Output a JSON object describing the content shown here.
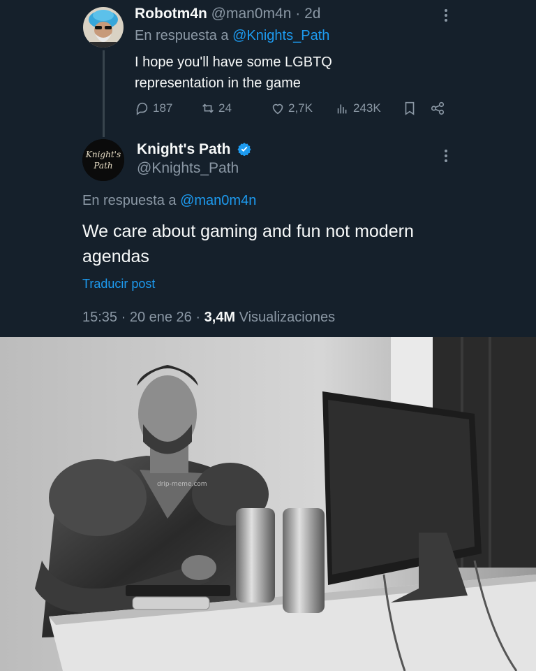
{
  "reply_tweet": {
    "name": "Robotm4n",
    "handle": "@man0m4n",
    "separator": "·",
    "time": "2d",
    "reply_prefix": "En respuesta a",
    "reply_to": "@Knights_Path",
    "text_line1": "I hope you'll have some LGBTQ",
    "text_line2": "representation in the game",
    "actions": {
      "replies": "187",
      "retweets": "24",
      "likes": "2,7K",
      "views": "243K"
    }
  },
  "main_tweet": {
    "name": "Knight's Path",
    "handle": "@Knights_Path",
    "avatar_text": [
      "Knight's",
      "Path"
    ],
    "reply_prefix": "En respuesta a",
    "reply_to": "@man0m4n",
    "text_line1": "We care about gaming and fun not modern",
    "text_line2": "agendas",
    "translate": "Traducir post",
    "timestamp": "15:35 · 20 ene 26 ·",
    "views_count": "3,4M",
    "views_label": "Visualizaciones"
  },
  "meme_image": {
    "watermark": "drip-meme.com"
  },
  "colors": {
    "background": "#15202b",
    "text_primary": "#f7f9f9",
    "text_secondary": "#8b98a5",
    "link": "#1d9bf0",
    "thread_line": "#38444d"
  },
  "icons": [
    "more-icon",
    "reply-icon",
    "retweet-icon",
    "like-icon",
    "views-icon",
    "bookmark-icon",
    "share-icon",
    "verified-icon"
  ]
}
